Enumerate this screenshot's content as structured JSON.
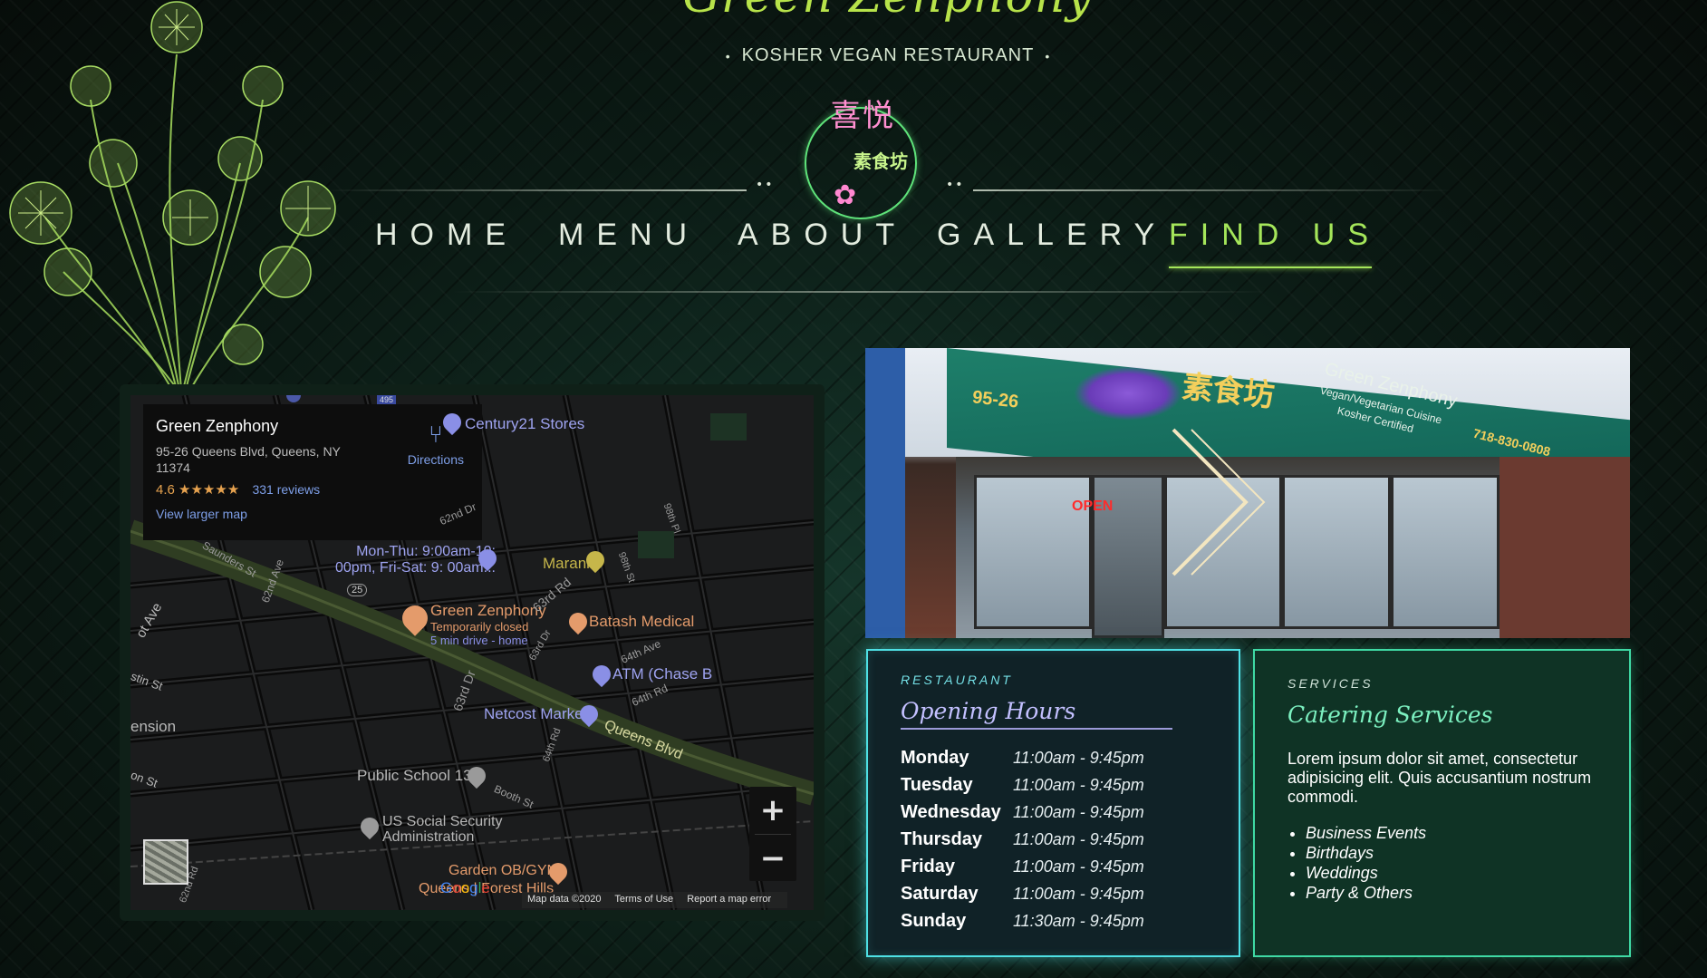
{
  "brand": {
    "title": "Green Zenphony",
    "subtitle": "KOSHER VEGAN RESTAURANT",
    "subtitle_dot": "•",
    "logo_top": "喜悦",
    "logo_mid": "素食坊",
    "lotus": "✿"
  },
  "nav": {
    "items": [
      {
        "label": "HOME"
      },
      {
        "label": "MENU"
      },
      {
        "label": "ABOUT"
      },
      {
        "label": "GALLERY"
      },
      {
        "label": "FIND US"
      }
    ],
    "active": "FIND US",
    "dots": "••"
  },
  "map": {
    "info": {
      "name": "Green Zenphony",
      "address": "95-26 Queens Blvd, Queens, NY 11374",
      "rating": "4.6",
      "stars": "★★★★★",
      "reviews": "331 reviews",
      "larger": "View larger map",
      "directions": "Directions",
      "directions_icon": "⑂"
    },
    "labels": {
      "century21": "Century21 Stores",
      "hours_pin": "Mon-Thu: 9:00am-10:\n00pm, Fri-Sat: 9: 00am...",
      "route25": "25",
      "marani": "Marani",
      "green_zenphony": "Green Zenphony",
      "temp_closed": "Temporarily closed",
      "drive": "5 min drive - home",
      "batash": "Batash Medical",
      "atm": "ATM (Chase B",
      "netcost": "Netcost Market",
      "queens_blvd": "Queens Blvd",
      "public_school": "Public School 139",
      "ssa": "US Social Security\nAdministration",
      "garden": "Garden OB/GYN",
      "queens_forest": "Queens | Forest Hills",
      "ext": "ension",
      "ot_ave": "ot Ave",
      "stin_st": "stin St",
      "on_st": "on St",
      "saunders": "Saunders St",
      "62nd_ave": "62nd Ave",
      "62nd_dr": "62nd Dr",
      "63rd_rd": "63rd Rd",
      "63rd_dr": "63rd Dr",
      "63rd_dr2": "63rd Dr",
      "64th_ave": "64th Ave",
      "64th_rd": "64th Rd",
      "64th_rd2": "64th Rd",
      "98th_st": "98th St",
      "98th_pl": "98th Pl",
      "booth": "Booth St",
      "62nd_rd": "62nd Rd",
      "495": "495"
    },
    "zoom_in": "+",
    "zoom_out": "−",
    "google": "Google",
    "footer": {
      "data": "Map data ©2020",
      "terms": "Terms of Use",
      "report": "Report a map error"
    }
  },
  "photo": {
    "address_number": "95-26",
    "sign_cn": "素食坊",
    "sign_en": "Green Zenphony",
    "sign_sub1": "Vegan/Vegetarian Cuisine",
    "sign_sub2": "Kosher Certified",
    "phone": "718-830-0808",
    "open": "OPEN"
  },
  "hours_card": {
    "eyebrow": "RESTAURANT",
    "title": "Opening Hours",
    "rows": [
      {
        "day": "Monday",
        "time": "11:00am - 9:45pm"
      },
      {
        "day": "Tuesday",
        "time": "11:00am - 9:45pm"
      },
      {
        "day": "Wednesday",
        "time": "11:00am - 9:45pm"
      },
      {
        "day": "Thursday",
        "time": "11:00am - 9:45pm"
      },
      {
        "day": "Friday",
        "time": "11:00am - 9:45pm"
      },
      {
        "day": "Saturday",
        "time": "11:00am - 9:45pm"
      },
      {
        "day": "Sunday",
        "time": "11:30am - 9:45pm"
      }
    ]
  },
  "services_card": {
    "eyebrow": "SERVICES",
    "title": "Catering Services",
    "body": "Lorem ipsum dolor sit amet, consectetur adipisicing elit. Quis accusantium nostrum commodi.",
    "list": [
      "Business Events",
      "Birthdays",
      "Weddings",
      "Party & Others"
    ]
  },
  "colors": {
    "accent_green": "#a5e65a",
    "cyan_border": "#4ee0e4",
    "services_border": "#3fd9a4",
    "title_purple": "#c3c0ff",
    "map_pin_orange": "#e49b6b",
    "map_pin_purple": "#8a8fe6"
  }
}
